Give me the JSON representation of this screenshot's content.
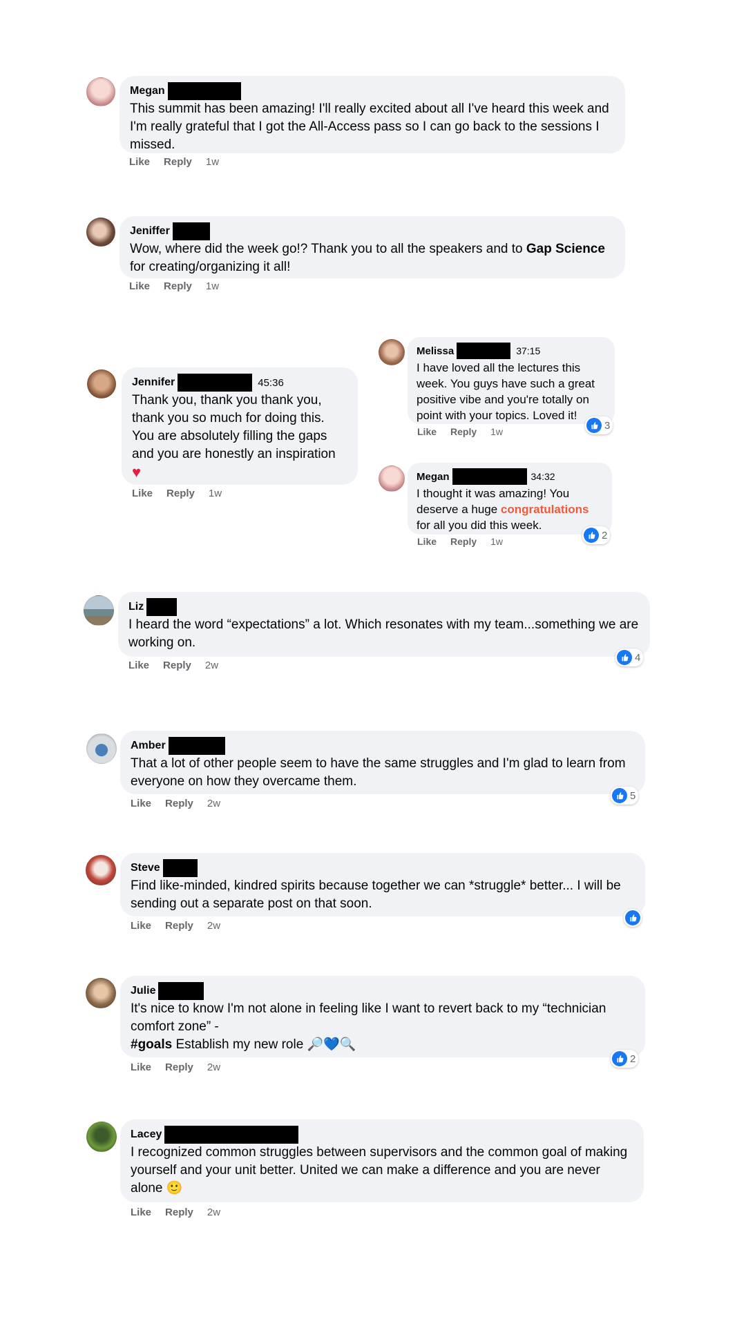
{
  "comments": {
    "c1": {
      "name": "Megan",
      "text": "This summit has been amazing! I'll really excited about all I've heard this week and I'm really grateful that I got the All-Access pass so I can go back to the sessions I missed.",
      "like": "Like",
      "reply": "Reply",
      "time": "1w"
    },
    "c2": {
      "name": "Jeniffer",
      "text_a": "Wow, where did the week go!? Thank you to all the speakers and to ",
      "text_bold": "Gap Science",
      "text_b": " for creating/organizing it all!",
      "like": "Like",
      "reply": "Reply",
      "time": "1w"
    },
    "c3": {
      "name": "Jennifer",
      "stamp": "45:36",
      "text": "Thank you, thank you thank you, thank you so much for doing this. You are absolutely filling the gaps and you are honestly an inspiration",
      "heart": "♥",
      "like": "Like",
      "reply": "Reply",
      "time": "1w"
    },
    "c3a": {
      "name": "Melissa",
      "stamp": "37:15",
      "text": "I have loved all the lectures this week. You guys have such a great positive vibe and you're totally on point with your topics. Loved it!",
      "like": "Like",
      "reply": "Reply",
      "time": "1w",
      "reactions": "3"
    },
    "c3b": {
      "name": "Megan",
      "stamp": "34:32",
      "text_a": "I thought it was amazing! You deserve a huge ",
      "text_color": "congratulations",
      "text_b": " for all you did this week.",
      "like": "Like",
      "reply": "Reply",
      "time": "1w",
      "reactions": "2"
    },
    "c4": {
      "name": "Liz",
      "text": "I heard the word “expectations” a lot. Which resonates with my team...something we are working on.",
      "like": "Like",
      "reply": "Reply",
      "time": "2w",
      "reactions": "4"
    },
    "c5": {
      "name": "Amber",
      "text": "That a lot of other people seem to have the same struggles and I'm glad to learn from everyone on how they overcame them.",
      "like": "Like",
      "reply": "Reply",
      "time": "2w",
      "reactions": "5"
    },
    "c6": {
      "name": "Steve",
      "text": "Find like-minded, kindred spirits because together we can *struggle* better... I will be sending out a separate post on that soon.",
      "like": "Like",
      "reply": "Reply",
      "time": "2w"
    },
    "c7": {
      "name": "Julie",
      "text_a": "It's nice to know I'm not alone in feeling like I want to revert back to my “technician comfort zone” -",
      "text_tag": "#goals",
      "text_b": " Establish my new role ",
      "emoji": "🔎💙🔍",
      "like": "Like",
      "reply": "Reply",
      "time": "2w",
      "reactions": "2"
    },
    "c8": {
      "name": "Lacey",
      "text": "I recognized common struggles between supervisors and the common goal of making yourself and your unit better. United we can make a difference and you are never alone ",
      "emoji": "🙂",
      "like": "Like",
      "reply": "Reply",
      "time": "2w"
    }
  },
  "colors": {
    "bubble": "#f0f2f5",
    "like_blue": "#1877f2",
    "meta_gray": "#65676b",
    "accent_orange": "#f05a3a",
    "heart_red": "#e41e3f"
  },
  "icons": {
    "like": "thumbs-up-icon",
    "heart": "heart-icon"
  }
}
